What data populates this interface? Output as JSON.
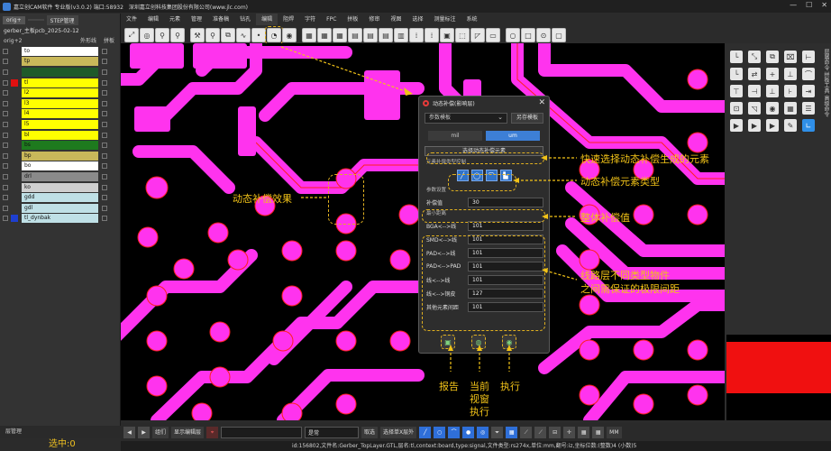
{
  "window": {
    "title": "嘉立创CAM软件 专业版(v3.0.2) 端口:58932",
    "company": "深圳嘉立创科技集团股份有限公司(www.jlc.com)",
    "controls": [
      "—",
      "☐",
      "✕"
    ]
  },
  "menu": [
    "文件",
    "编辑",
    "元素",
    "管理",
    "准备稿",
    "钻孔",
    "编辑",
    "阻焊",
    "字符",
    "FPC",
    "拼板",
    "修审",
    "视图",
    "选择",
    "测量标注",
    "系统"
  ],
  "left_panel": {
    "tabs": [
      "orig+",
      "",
      "STEP管理"
    ],
    "file": "gerber_主板pcb_2025-02-12",
    "step": "orig+2",
    "opt_outline": "外形线",
    "opt_panel": "拼板",
    "layers": [
      {
        "name": "to",
        "color": "#ffffff",
        "swatch": ""
      },
      {
        "name": "tp",
        "color": "#c9b85a",
        "swatch": ""
      },
      {
        "name": "",
        "color": "#1f5a2a",
        "swatch": ""
      },
      {
        "name": "tl",
        "color": "#ffff00",
        "swatch": "#e01010"
      },
      {
        "name": "l2",
        "color": "#ffff00",
        "swatch": ""
      },
      {
        "name": "l3",
        "color": "#ffff00",
        "swatch": ""
      },
      {
        "name": "l4",
        "color": "#ffff00",
        "swatch": ""
      },
      {
        "name": "l5",
        "color": "#ffff00",
        "swatch": ""
      },
      {
        "name": "bl",
        "color": "#ffff00",
        "swatch": ""
      },
      {
        "name": "bs",
        "color": "#1e7a1e",
        "swatch": ""
      },
      {
        "name": "bp",
        "color": "#c9b85a",
        "swatch": ""
      },
      {
        "name": "bo",
        "color": "#ffffff",
        "swatch": ""
      },
      {
        "name": "drl",
        "color": "#8a8a8a",
        "swatch": ""
      },
      {
        "name": "ko",
        "color": "#cfcfcf",
        "swatch": ""
      },
      {
        "name": "gdd",
        "color": "#bfe0e6",
        "swatch": ""
      },
      {
        "name": "gdl",
        "color": "#bfe0e6",
        "swatch": ""
      },
      {
        "name": "tl_dynbak",
        "color": "#bfe0e6",
        "swatch": "#1e3fd0"
      }
    ],
    "layer_manager": "层管理",
    "selected": "选中:0"
  },
  "dialog": {
    "title": "动态补偿(影响层)",
    "close": "✕",
    "template_select": "参数模板",
    "save_template": "另存模板",
    "unit_mil": "mil",
    "unit_um": "um",
    "pick_elements": "选择动态补偿元素",
    "elements_label": "元素补偿类型控制",
    "type_icons": [
      "╱",
      "◯",
      "⌒",
      "▙"
    ],
    "param_label": "参数设置",
    "compensation": {
      "label": "补偿值",
      "value": "30"
    },
    "min_spacing_label": "最小距离",
    "spacings": [
      {
        "label": "BGA<-->线",
        "value": "101"
      },
      {
        "label": "SMD<-->线",
        "value": "101"
      },
      {
        "label": "PAD<-->线",
        "value": "101"
      },
      {
        "label": "PAD<-->PAD",
        "value": "101"
      },
      {
        "label": "线<-->线",
        "value": "101"
      },
      {
        "label": "线<-->铜皮",
        "value": "127"
      },
      {
        "label": "其他元素间距",
        "value": "101"
      }
    ]
  },
  "callouts": {
    "effect": "动态补偿效果",
    "quick_select": "快速选择动态补偿生成的元素",
    "element_type": "动态补偿元素类型",
    "overall_value": "整体补偿值",
    "min_spacing_1": "线路层不同类型物件",
    "min_spacing_2": "之间需保证的极限间距",
    "report": "报告",
    "current_1": "当前",
    "current_2": "视窗",
    "current_3": "执行",
    "execute": "执行"
  },
  "right_panel": {
    "vtabs": "层属命令 拼板工具 高级命令"
  },
  "statusbar": {
    "combo1": "组们",
    "btn_show": "显示编辑层",
    "input_text": "",
    "combo2": "是常",
    "opt1": "取选",
    "opt2": "选择单X层外",
    "unit": "MM"
  },
  "infobar": "id:156802,文件名:Gerber_TopLayer.GTL,层名:tl,context:board,type:signal,文件类型:rs274x,单位:mm,翻号:iz,坐标位数:(整数)4 (小数)5",
  "colors": {
    "copper": "#ff33ee",
    "bg": "#000000",
    "accent": "#f2c318"
  }
}
